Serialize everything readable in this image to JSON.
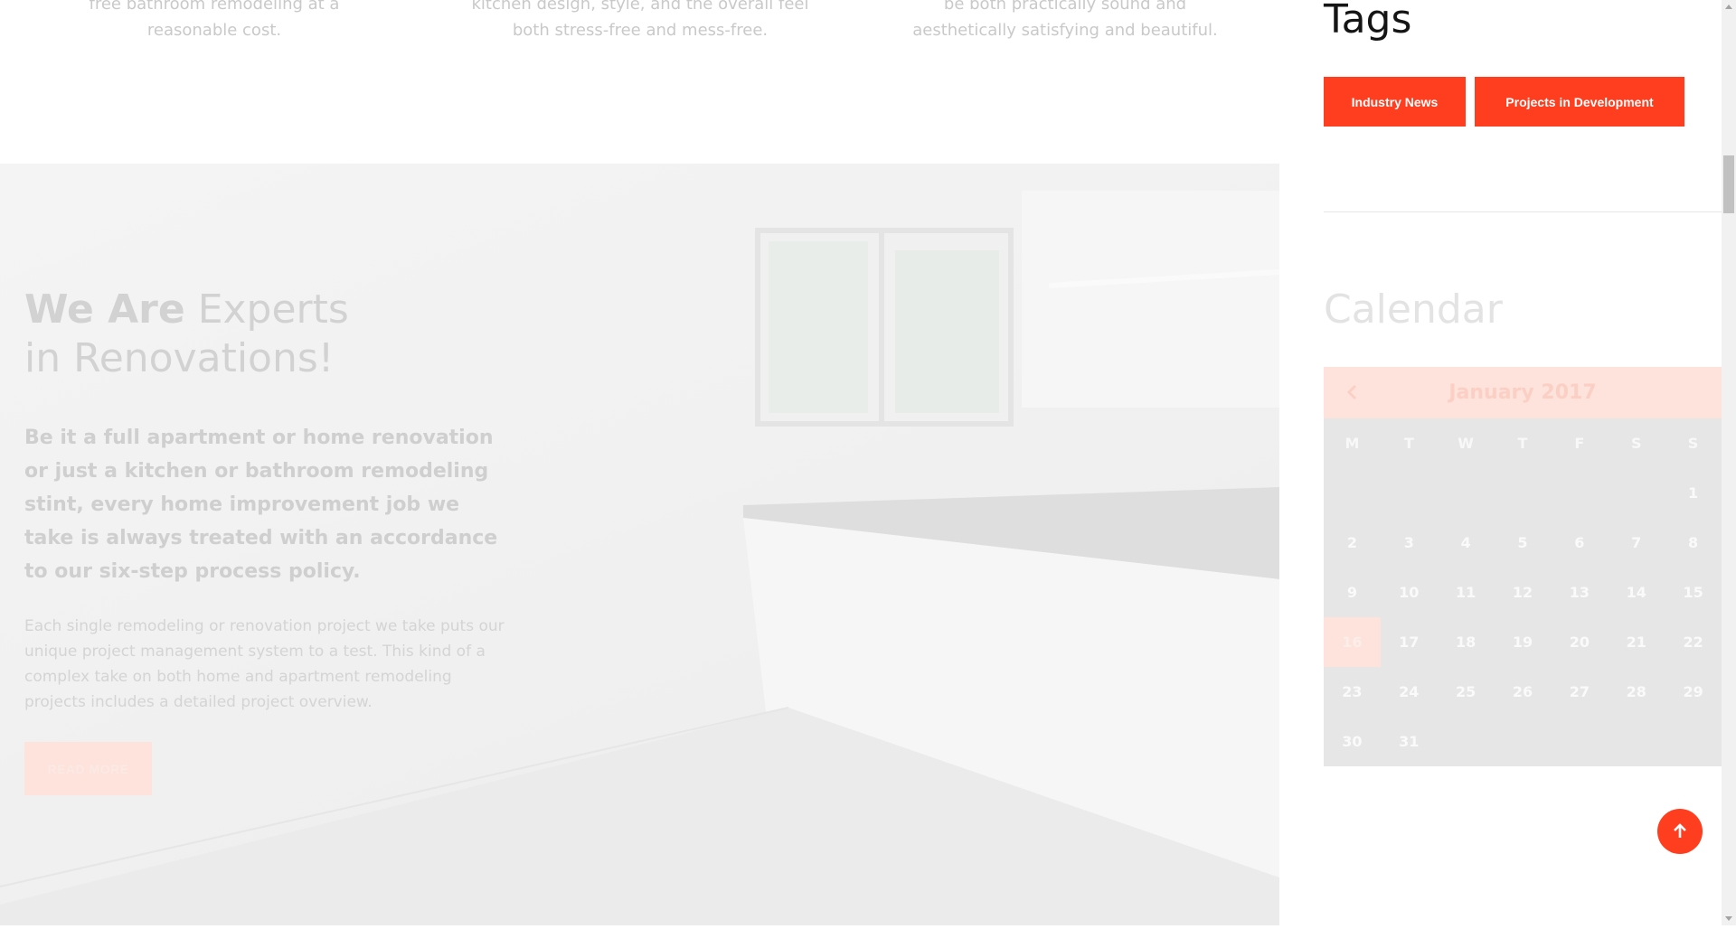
{
  "services": {
    "col1": [
      "free bathroom remodeling at a",
      "reasonable cost."
    ],
    "col2": [
      "kitchen design, style, and the overall feel",
      "both stress-free and mess-free."
    ],
    "col3": [
      "be both practically sound and",
      "aesthetically satisfying and beautiful."
    ]
  },
  "hero": {
    "heading_strong": "We Are",
    "heading_rest": " Experts",
    "heading_line2": "in Renovations!",
    "lead": "Be it a full apartment or home renovation or just a kitchen or bathroom remodeling stint, every home improvement job we take is always treated with an accordance to our six-step process policy.",
    "body": "Each single remodeling or renovation project we take puts our unique project management system to a test. This kind of a complex take on both home and apartment remodeling projects includes a detailed project overview.",
    "button_label": "READ MORE"
  },
  "sidebar": {
    "tags_title": "Tags",
    "tags": [
      "Industry News",
      "Projects in Development"
    ],
    "calendar_title": "Calendar",
    "calendar": {
      "month_label": "January 2017",
      "weekdays": [
        "M",
        "T",
        "W",
        "T",
        "F",
        "S",
        "S"
      ],
      "leading_blank_days": 6,
      "days_in_month": 31,
      "today": 16
    }
  },
  "colors": {
    "accent": "#ff3d1f",
    "accent_faded": "#fde3dc",
    "calendar_bg": "#e6e6e6"
  },
  "icons": {
    "calendar_prev": "chevron-left-icon",
    "back_to_top": "arrow-up-icon",
    "scroll_up": "triangle-up-icon",
    "scroll_down": "triangle-down-icon"
  }
}
